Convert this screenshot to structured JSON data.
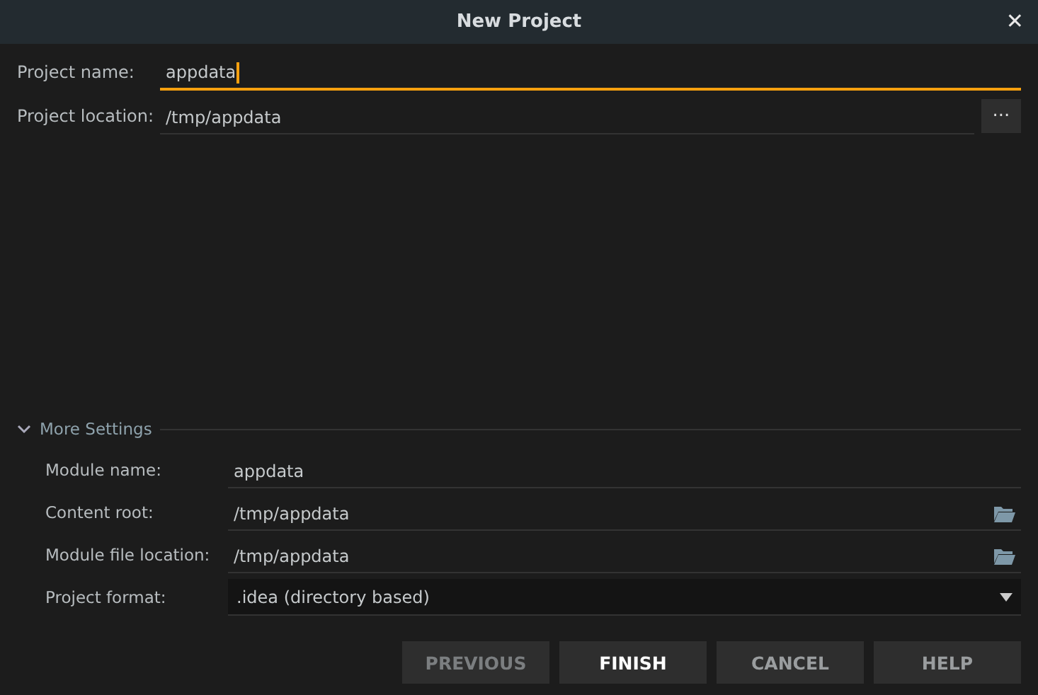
{
  "window": {
    "title": "New Project",
    "close": "✕"
  },
  "project_fields": [
    {
      "label": "Project name:",
      "value": "appdata",
      "focused": true
    },
    {
      "label": "Project location:",
      "value": "/tmp/appdata",
      "focused": false,
      "browse_button": "..."
    }
  ],
  "more_settings": {
    "title": "More Settings",
    "expanded": true,
    "fields": [
      {
        "kind": "text",
        "label": "Module name:",
        "value": "appdata"
      },
      {
        "kind": "text",
        "label": "Content root:",
        "value": "/tmp/appdata",
        "folder": true
      },
      {
        "kind": "text",
        "label": "Module file location:",
        "value": "/tmp/appdata",
        "folder": true
      },
      {
        "kind": "dropdown",
        "label": "Project format:",
        "value": ".idea (directory based)"
      }
    ]
  },
  "buttons": [
    {
      "label": "PREVIOUS",
      "disabled": true,
      "default": false
    },
    {
      "label": "FINISH",
      "disabled": false,
      "default": true
    },
    {
      "label": "CANCEL",
      "disabled": false,
      "default": false
    },
    {
      "label": "HELP",
      "disabled": false,
      "default": false
    }
  ]
}
